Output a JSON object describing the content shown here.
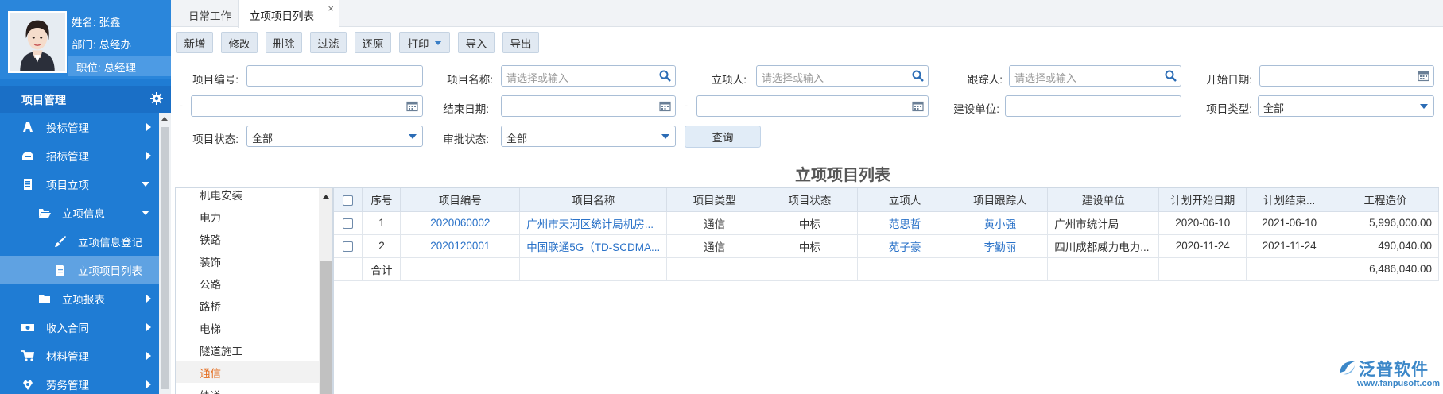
{
  "profile": {
    "name_line": "姓名: 张鑫",
    "dept_line": "部门: 总经办",
    "position_line": "职位: 总经理"
  },
  "module": {
    "title": "项目管理"
  },
  "menu": [
    {
      "label": "投标管理",
      "icon": "bid-icon"
    },
    {
      "label": "招标管理",
      "icon": "tender-icon"
    },
    {
      "label": "项目立项",
      "icon": "document-icon"
    },
    {
      "label": "立项信息",
      "icon": "folder-open-icon"
    },
    {
      "label": "立项信息登记",
      "icon": "brush-icon"
    },
    {
      "label": "立项项目列表",
      "icon": "file-icon"
    },
    {
      "label": "立项报表",
      "icon": "folder-icon"
    },
    {
      "label": "收入合同",
      "icon": "money-icon"
    },
    {
      "label": "材料管理",
      "icon": "cart-icon"
    },
    {
      "label": "劳务管理",
      "icon": "worker-icon"
    }
  ],
  "tabs": [
    {
      "label": "日常工作"
    },
    {
      "label": "立项项目列表",
      "close": "×"
    }
  ],
  "toolbar": {
    "add": "新增",
    "edit": "修改",
    "delete": "删除",
    "filter": "过滤",
    "restore": "还原",
    "print": "打印",
    "import": "导入",
    "export": "导出"
  },
  "filters": {
    "project_no": {
      "label": "项目编号:",
      "value": ""
    },
    "project_name": {
      "label": "项目名称:",
      "placeholder": "请选择或输入"
    },
    "initiator": {
      "label": "立项人:",
      "placeholder": "请选择或输入"
    },
    "follower": {
      "label": "跟踪人:",
      "placeholder": "请选择或输入"
    },
    "start_date": {
      "label": "开始日期:",
      "value": ""
    },
    "range_sep": "-",
    "end_date": {
      "label": "结束日期:",
      "value": ""
    },
    "build_unit": {
      "label": "建设单位:",
      "value": ""
    },
    "project_type": {
      "label": "项目类型:",
      "value": "全部"
    },
    "project_status": {
      "label": "项目状态:",
      "value": "全部"
    },
    "approval_status": {
      "label": "审批状态:",
      "value": "全部"
    },
    "query_button": "查询"
  },
  "list_title": "立项项目列表",
  "categories": [
    "机电安装",
    "电力",
    "铁路",
    "装饰",
    "公路",
    "路桥",
    "电梯",
    "隧道施工",
    "通信",
    "轨道"
  ],
  "selected_category": "通信",
  "grid": {
    "headers": [
      "序号",
      "项目编号",
      "项目名称",
      "项目类型",
      "项目状态",
      "立项人",
      "项目跟踪人",
      "建设单位",
      "计划开始日期",
      "计划结束...",
      "工程造价"
    ],
    "rows": [
      {
        "seq": "1",
        "no": "2020060002",
        "name": "广州市天河区统计局机房...",
        "type": "通信",
        "status": "中标",
        "initiator": "范思哲",
        "follower": "黄小强",
        "unit": "广州市统计局",
        "start": "2020-06-10",
        "end": "2021-06-10",
        "cost": "5,996,000.00"
      },
      {
        "seq": "2",
        "no": "2020120001",
        "name": "中国联通5G（TD-SCDMA...",
        "type": "通信",
        "status": "中标",
        "initiator": "苑子豪",
        "follower": "李勤丽",
        "unit": "四川成都威力电力...",
        "start": "2020-11-24",
        "end": "2021-11-24",
        "cost": "490,040.00"
      }
    ],
    "total_label": "合计",
    "total_cost": "6,486,040.00"
  },
  "watermark": {
    "brand": "泛普软件",
    "url": "www.fanpusoft.com"
  },
  "colors": {
    "sidebar": "#1f7cd4",
    "active_menu": "#5fa2e2",
    "link": "#2a72c8",
    "selected_category": "#e46a1a"
  }
}
